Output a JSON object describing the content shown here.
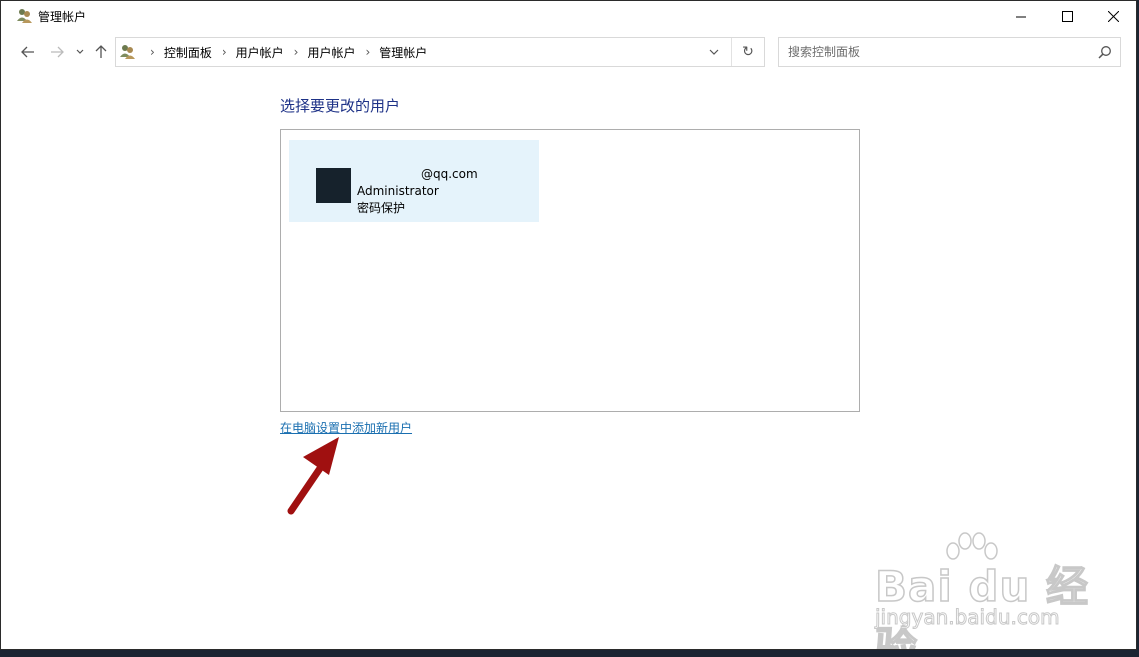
{
  "window": {
    "title": "管理帐户",
    "icon": "user-accounts-icon"
  },
  "titlebar_buttons": [
    "minimize-icon",
    "maximize-icon",
    "close-icon"
  ],
  "nav": {
    "back_icon": "arrow-left-icon",
    "forward_icon": "arrow-right-icon",
    "recent_icon": "chevron-down-icon",
    "up_icon": "arrow-up-icon"
  },
  "address": {
    "breadcrumbs": [
      "控制面板",
      "用户帐户",
      "用户帐户",
      "管理帐户"
    ],
    "separator": "›",
    "refresh_glyph": "↻"
  },
  "search": {
    "placeholder": "搜索控制面板",
    "value": ""
  },
  "main": {
    "heading": "选择要更改的用户",
    "users": [
      {
        "email": "@qq.com",
        "type": "Administrator",
        "status": "密码保护"
      }
    ],
    "add_user_link": "在电脑设置中添加新用户"
  },
  "watermark": {
    "logo": "Bai du 经验",
    "url": "jingyan.baidu.com"
  },
  "colors": {
    "heading": "#1e3287",
    "link": "#1a6fb0",
    "tile_selected": "#e5f3fb",
    "annotation_arrow": "#a01010"
  }
}
